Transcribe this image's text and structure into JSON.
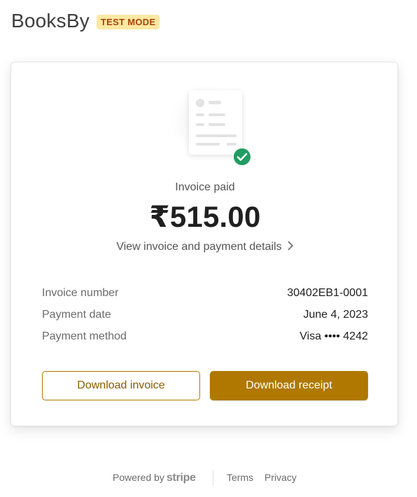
{
  "header": {
    "brand": "BooksBy",
    "badge": "TEST MODE"
  },
  "card": {
    "status": "Invoice paid",
    "amount": "₹515.00",
    "details_link": "View invoice and payment details",
    "details_icon": "chevron-right-icon",
    "rows": [
      {
        "label": "Invoice number",
        "value": "30402EB1-0001"
      },
      {
        "label": "Payment date",
        "value": "June 4, 2023"
      },
      {
        "label": "Payment method",
        "value": "Visa •••• 4242"
      }
    ],
    "download_invoice": "Download invoice",
    "download_receipt": "Download receipt"
  },
  "footer": {
    "powered_by": "Powered by",
    "stripe": "stripe",
    "terms": "Terms",
    "privacy": "Privacy"
  },
  "colors": {
    "accent": "#b07800",
    "success": "#1f9d63",
    "badge_bg": "#fde8a3",
    "badge_text": "#a8430a"
  }
}
